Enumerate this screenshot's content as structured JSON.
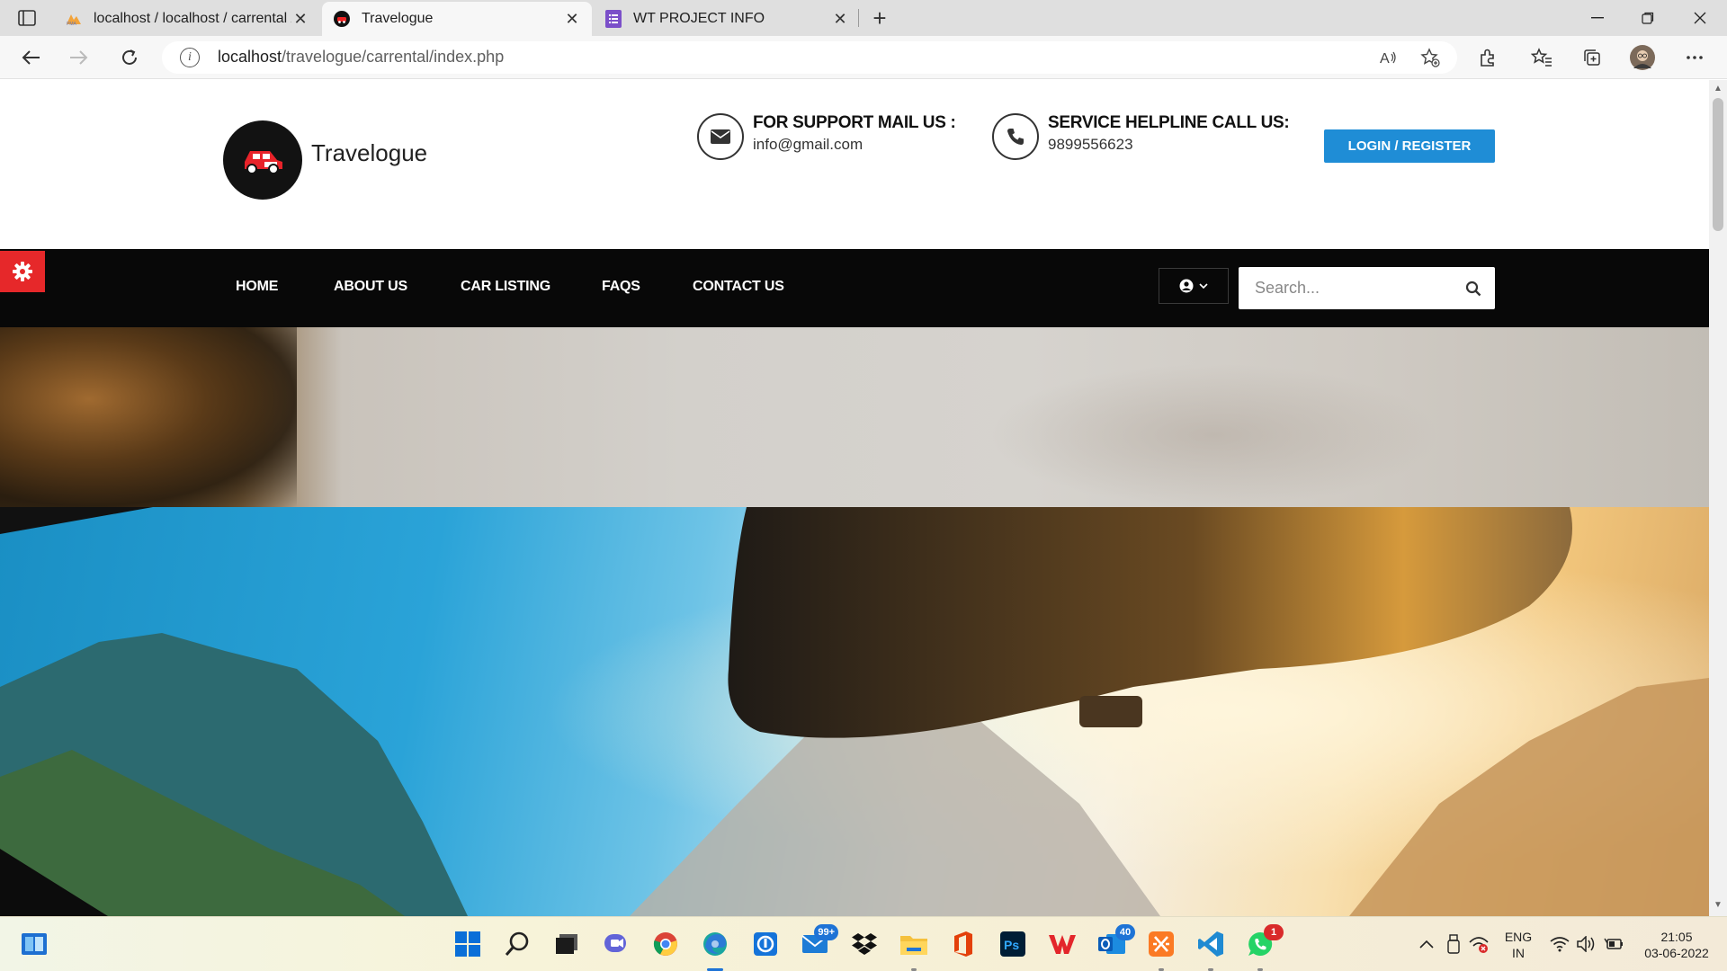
{
  "browser": {
    "tabs": [
      {
        "title": "localhost / localhost / carrental /",
        "favicon": "phpmyadmin-icon",
        "active": false
      },
      {
        "title": "Travelogue",
        "favicon": "car-logo-icon",
        "active": true
      },
      {
        "title": "WT PROJECT INFO",
        "favicon": "forms-icon",
        "active": false
      }
    ],
    "url_host": "localhost",
    "url_path": "/travelogue/carrental/index.php"
  },
  "site": {
    "brand": "Travelogue",
    "support": {
      "heading": "FOR SUPPORT MAIL US :",
      "value": "info@gmail.com"
    },
    "helpline": {
      "heading": "SERVICE HELPLINE CALL US:",
      "value": "9899556623"
    },
    "login_label": "LOGIN / REGISTER",
    "nav": [
      "HOME",
      "ABOUT US",
      "CAR LISTING",
      "FAQS",
      "CONTACT US"
    ],
    "search_placeholder": "Search..."
  },
  "taskbar": {
    "mail_badge": "99+",
    "outlook_badge": "40",
    "whatsapp_badge": "1",
    "lang_line1": "ENG",
    "lang_line2": "IN",
    "time": "21:05",
    "date": "03-06-2022"
  },
  "colors": {
    "accent_blue": "#1f8dd6",
    "nav_bg": "#080808",
    "gear_red": "#e6282a"
  }
}
